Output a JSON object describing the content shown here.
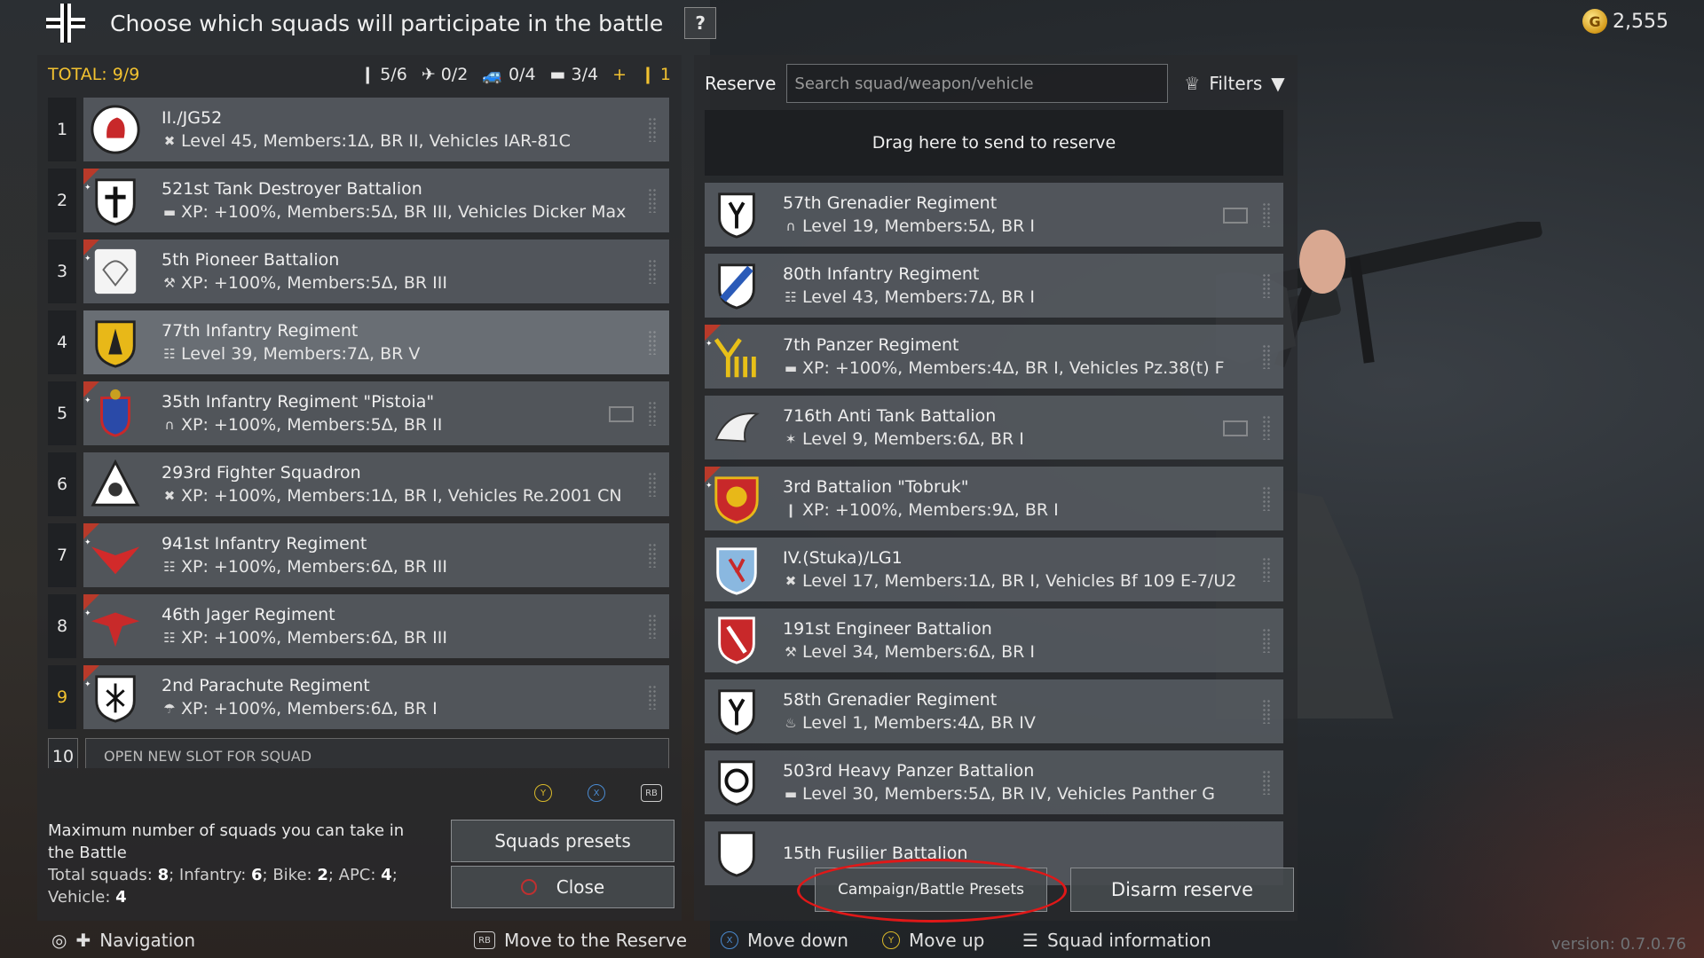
{
  "header": {
    "title": "Choose which squads will participate in the battle",
    "help_label": "?",
    "gold": "2,555"
  },
  "left": {
    "total": "TOTAL: 9/9",
    "counts": {
      "infantry": "5/6",
      "aircraft": "0/2",
      "apc": "0/4",
      "tank": "3/4",
      "plus": "+",
      "extra": "1"
    },
    "squads": [
      {
        "num": "1",
        "name": "II./JG52",
        "info": "Level 45, Members:1Δ, BR II, Vehicles IAR-81C",
        "icon": "aircraft-icon",
        "premium": false
      },
      {
        "num": "2",
        "name": "521st Tank Destroyer Battalion",
        "info": "XP: +100%, Members:5Δ, BR III, Vehicles Dicker Max",
        "icon": "tank-icon",
        "premium": true
      },
      {
        "num": "3",
        "name": "5th Pioneer Battalion",
        "info": "XP: +100%, Members:5Δ, BR III",
        "icon": "wrench-icon",
        "premium": true
      },
      {
        "num": "4",
        "name": "77th Infantry Regiment",
        "info": "Level 39, Members:7Δ, BR V",
        "icon": "infantry-icon",
        "premium": false
      },
      {
        "num": "5",
        "name": "35th Infantry Regiment \"Pistoia\"",
        "info": "XP: +100%, Members:5Δ, BR II",
        "icon": "radio-icon",
        "premium": true
      },
      {
        "num": "6",
        "name": "293rd Fighter Squadron",
        "info": "XP: +100%, Members:1Δ, BR I, Vehicles Re.2001 CN",
        "icon": "aircraft-icon",
        "premium": false
      },
      {
        "num": "7",
        "name": "941st Infantry Regiment",
        "info": "XP: +100%, Members:6Δ, BR III",
        "icon": "infantry-icon",
        "premium": true
      },
      {
        "num": "8",
        "name": "46th Jager Regiment",
        "info": "XP: +100%, Members:6Δ, BR III",
        "icon": "infantry-icon",
        "premium": true
      },
      {
        "num": "9",
        "name": "2nd Parachute Regiment",
        "info": "XP: +100%, Members:6Δ, BR I",
        "icon": "parachute-icon",
        "premium": true
      }
    ],
    "open_slot": {
      "num": "10",
      "label": "OPEN NEW SLOT FOR SQUAD"
    },
    "max_info": {
      "line1": "Maximum number of squads you can take in the Battle",
      "total_label": "Total squads: ",
      "total": "8",
      "inf_label": "; Infantry: ",
      "inf": "6",
      "bike_label": "; Bike: ",
      "bike": "2",
      "apc_label": "; APC: ",
      "apc": "4",
      "veh_label": "; Vehicle: ",
      "veh": "4"
    },
    "squad_presets_label": "Squads presets",
    "close_label": "Close"
  },
  "right": {
    "reserve_label": "Reserve",
    "search_placeholder": "Search squad/weapon/vehicle",
    "filters_label": "Filters",
    "drop_label": "Drag here to send to reserve",
    "reserve": [
      {
        "name": "57th Grenadier Regiment",
        "info": "Level 19, Members:5Δ, BR I",
        "icon": "radio-icon",
        "premium": false
      },
      {
        "name": "80th Infantry Regiment",
        "info": "Level 43, Members:7Δ, BR I",
        "icon": "infantry-icon",
        "premium": false
      },
      {
        "name": "7th Panzer Regiment",
        "info": "XP: +100%, Members:4Δ, BR I, Vehicles Pz.38(t) F",
        "icon": "tank-icon",
        "premium": true
      },
      {
        "name": "716th Anti Tank Battalion",
        "info": "Level 9, Members:6Δ, BR I",
        "icon": "antitank-icon",
        "premium": false
      },
      {
        "name": "3rd Battalion \"Tobruk\"",
        "info": "XP: +100%, Members:9Δ, BR I",
        "icon": "sniper-icon",
        "premium": true
      },
      {
        "name": "IV.(Stuka)/LG1",
        "info": "Level 17, Members:1Δ, BR I, Vehicles Bf 109 E-7/U2",
        "icon": "aircraft-icon",
        "premium": false
      },
      {
        "name": "191st Engineer Battalion",
        "info": "Level 34, Members:6Δ, BR I",
        "icon": "wrench-icon",
        "premium": false
      },
      {
        "name": "58th Grenadier Regiment",
        "info": "Level 1, Members:4Δ, BR IV",
        "icon": "flame-icon",
        "premium": false
      },
      {
        "name": "503rd Heavy Panzer Battalion",
        "info": "Level 30, Members:5Δ, BR IV, Vehicles Panther G",
        "icon": "tank-icon",
        "premium": false
      },
      {
        "name": "15th Fusilier Battalion",
        "info": "",
        "icon": "infantry-icon",
        "premium": false
      }
    ],
    "campaign_presets_label": "Campaign/Battle Presets",
    "disarm_label": "Disarm reserve"
  },
  "bottom": {
    "navigation": "Navigation",
    "move_reserve": "Move to the Reserve",
    "move_down": "Move down",
    "move_up": "Move up",
    "squad_info": "Squad information",
    "version": "version: 0.7.0.76"
  },
  "colors": {
    "accent_yellow": "#f2c230",
    "premium_red": "#b93a2a",
    "highlight_red": "#e01818"
  }
}
